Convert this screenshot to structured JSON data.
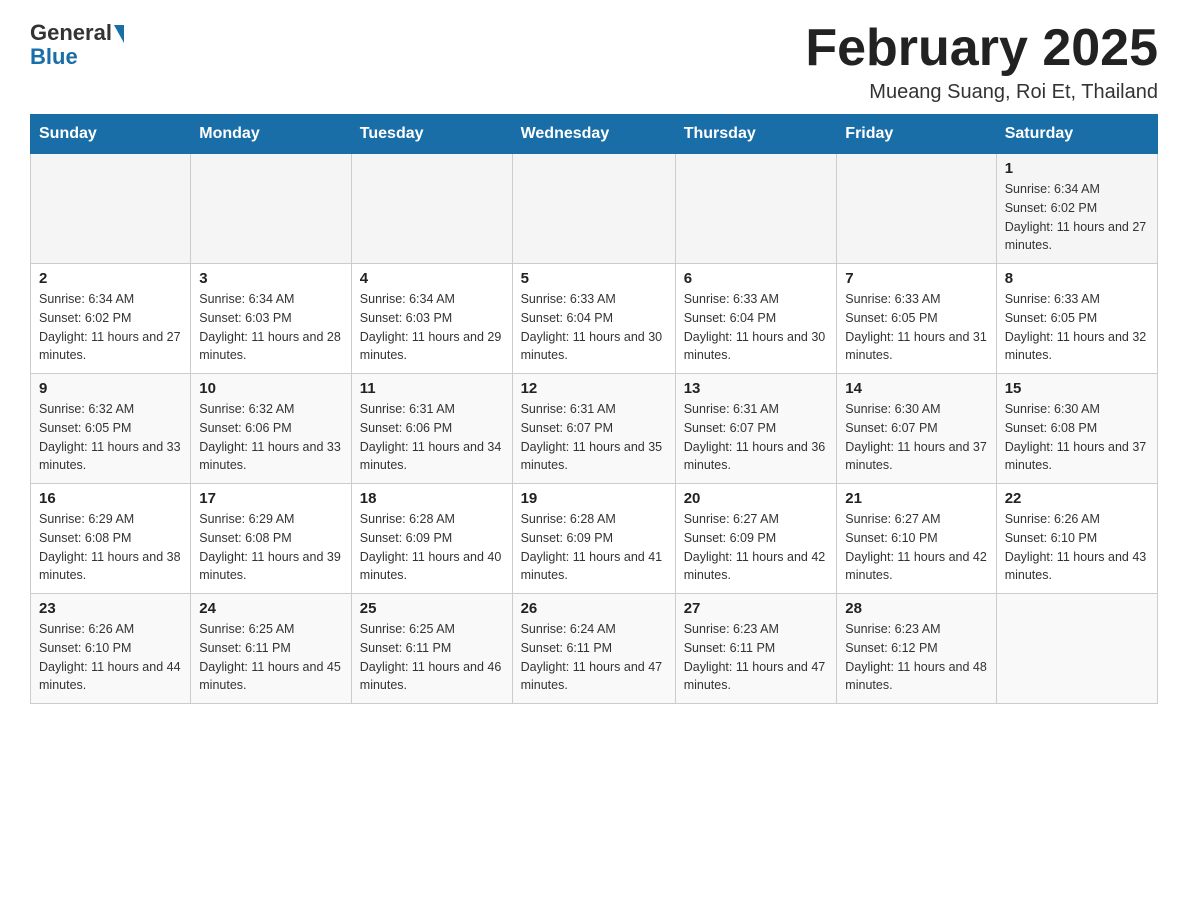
{
  "logo": {
    "general": "General",
    "blue": "Blue"
  },
  "title": "February 2025",
  "location": "Mueang Suang, Roi Et, Thailand",
  "weekdays": [
    "Sunday",
    "Monday",
    "Tuesday",
    "Wednesday",
    "Thursday",
    "Friday",
    "Saturday"
  ],
  "weeks": [
    [
      {
        "day": "",
        "info": ""
      },
      {
        "day": "",
        "info": ""
      },
      {
        "day": "",
        "info": ""
      },
      {
        "day": "",
        "info": ""
      },
      {
        "day": "",
        "info": ""
      },
      {
        "day": "",
        "info": ""
      },
      {
        "day": "1",
        "info": "Sunrise: 6:34 AM\nSunset: 6:02 PM\nDaylight: 11 hours and 27 minutes."
      }
    ],
    [
      {
        "day": "2",
        "info": "Sunrise: 6:34 AM\nSunset: 6:02 PM\nDaylight: 11 hours and 27 minutes."
      },
      {
        "day": "3",
        "info": "Sunrise: 6:34 AM\nSunset: 6:03 PM\nDaylight: 11 hours and 28 minutes."
      },
      {
        "day": "4",
        "info": "Sunrise: 6:34 AM\nSunset: 6:03 PM\nDaylight: 11 hours and 29 minutes."
      },
      {
        "day": "5",
        "info": "Sunrise: 6:33 AM\nSunset: 6:04 PM\nDaylight: 11 hours and 30 minutes."
      },
      {
        "day": "6",
        "info": "Sunrise: 6:33 AM\nSunset: 6:04 PM\nDaylight: 11 hours and 30 minutes."
      },
      {
        "day": "7",
        "info": "Sunrise: 6:33 AM\nSunset: 6:05 PM\nDaylight: 11 hours and 31 minutes."
      },
      {
        "day": "8",
        "info": "Sunrise: 6:33 AM\nSunset: 6:05 PM\nDaylight: 11 hours and 32 minutes."
      }
    ],
    [
      {
        "day": "9",
        "info": "Sunrise: 6:32 AM\nSunset: 6:05 PM\nDaylight: 11 hours and 33 minutes."
      },
      {
        "day": "10",
        "info": "Sunrise: 6:32 AM\nSunset: 6:06 PM\nDaylight: 11 hours and 33 minutes."
      },
      {
        "day": "11",
        "info": "Sunrise: 6:31 AM\nSunset: 6:06 PM\nDaylight: 11 hours and 34 minutes."
      },
      {
        "day": "12",
        "info": "Sunrise: 6:31 AM\nSunset: 6:07 PM\nDaylight: 11 hours and 35 minutes."
      },
      {
        "day": "13",
        "info": "Sunrise: 6:31 AM\nSunset: 6:07 PM\nDaylight: 11 hours and 36 minutes."
      },
      {
        "day": "14",
        "info": "Sunrise: 6:30 AM\nSunset: 6:07 PM\nDaylight: 11 hours and 37 minutes."
      },
      {
        "day": "15",
        "info": "Sunrise: 6:30 AM\nSunset: 6:08 PM\nDaylight: 11 hours and 37 minutes."
      }
    ],
    [
      {
        "day": "16",
        "info": "Sunrise: 6:29 AM\nSunset: 6:08 PM\nDaylight: 11 hours and 38 minutes."
      },
      {
        "day": "17",
        "info": "Sunrise: 6:29 AM\nSunset: 6:08 PM\nDaylight: 11 hours and 39 minutes."
      },
      {
        "day": "18",
        "info": "Sunrise: 6:28 AM\nSunset: 6:09 PM\nDaylight: 11 hours and 40 minutes."
      },
      {
        "day": "19",
        "info": "Sunrise: 6:28 AM\nSunset: 6:09 PM\nDaylight: 11 hours and 41 minutes."
      },
      {
        "day": "20",
        "info": "Sunrise: 6:27 AM\nSunset: 6:09 PM\nDaylight: 11 hours and 42 minutes."
      },
      {
        "day": "21",
        "info": "Sunrise: 6:27 AM\nSunset: 6:10 PM\nDaylight: 11 hours and 42 minutes."
      },
      {
        "day": "22",
        "info": "Sunrise: 6:26 AM\nSunset: 6:10 PM\nDaylight: 11 hours and 43 minutes."
      }
    ],
    [
      {
        "day": "23",
        "info": "Sunrise: 6:26 AM\nSunset: 6:10 PM\nDaylight: 11 hours and 44 minutes."
      },
      {
        "day": "24",
        "info": "Sunrise: 6:25 AM\nSunset: 6:11 PM\nDaylight: 11 hours and 45 minutes."
      },
      {
        "day": "25",
        "info": "Sunrise: 6:25 AM\nSunset: 6:11 PM\nDaylight: 11 hours and 46 minutes."
      },
      {
        "day": "26",
        "info": "Sunrise: 6:24 AM\nSunset: 6:11 PM\nDaylight: 11 hours and 47 minutes."
      },
      {
        "day": "27",
        "info": "Sunrise: 6:23 AM\nSunset: 6:11 PM\nDaylight: 11 hours and 47 minutes."
      },
      {
        "day": "28",
        "info": "Sunrise: 6:23 AM\nSunset: 6:12 PM\nDaylight: 11 hours and 48 minutes."
      },
      {
        "day": "",
        "info": ""
      }
    ]
  ]
}
